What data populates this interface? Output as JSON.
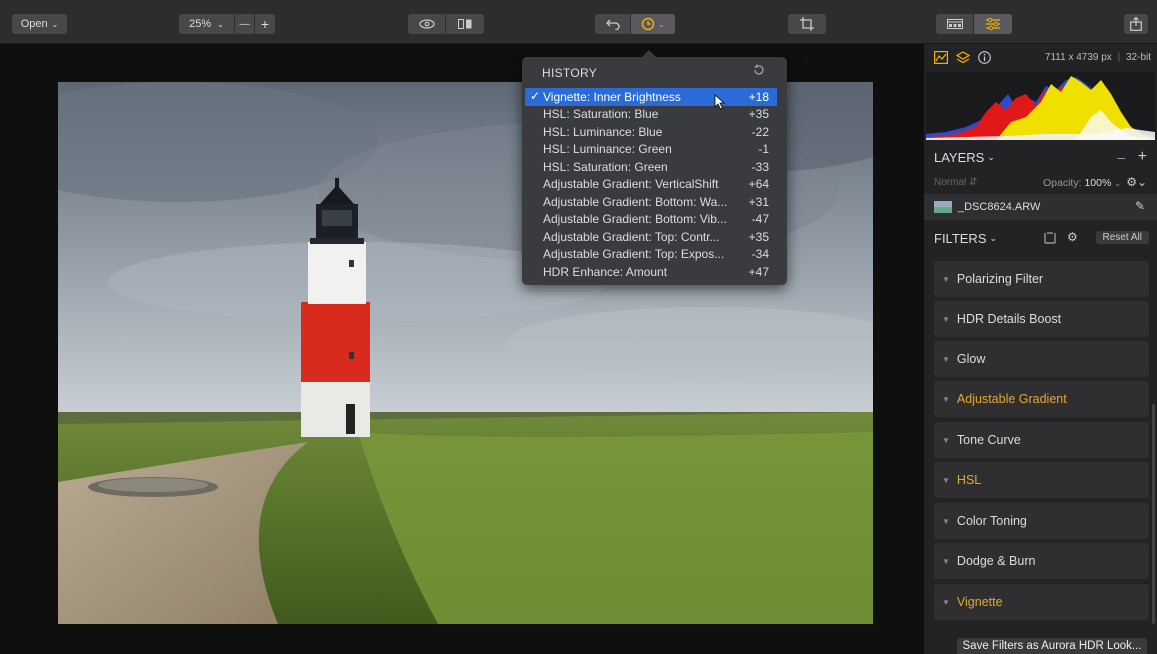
{
  "toolbar": {
    "open_label": "Open",
    "zoom_value": "25%",
    "zoom_minus": "—",
    "zoom_plus": "+"
  },
  "history": {
    "title": "HISTORY",
    "items": [
      {
        "label": "Vignette: Inner Brightness",
        "value": "+18",
        "selected": true
      },
      {
        "label": "HSL: Saturation: Blue",
        "value": "+35"
      },
      {
        "label": "HSL: Luminance: Blue",
        "value": "-22"
      },
      {
        "label": "HSL: Luminance: Green",
        "value": "-1"
      },
      {
        "label": "HSL: Saturation: Green",
        "value": "-33"
      },
      {
        "label": "Adjustable Gradient: VerticalShift",
        "value": "+64"
      },
      {
        "label": "Adjustable Gradient: Bottom: Wa...",
        "value": "+31"
      },
      {
        "label": "Adjustable Gradient: Bottom: Vib...",
        "value": "-47"
      },
      {
        "label": "Adjustable Gradient: Top: Contr...",
        "value": "+35"
      },
      {
        "label": "Adjustable Gradient: Top: Expos...",
        "value": "-34"
      },
      {
        "label": "HDR Enhance: Amount",
        "value": "+47"
      }
    ]
  },
  "image_info": {
    "dimensions": "7111 x 4739 px",
    "bit_depth": "32-bit"
  },
  "layers": {
    "title": "LAYERS",
    "blend_mode": "Normal",
    "opacity_label": "Opacity:",
    "opacity_value": "100%",
    "layer_name": "_DSC8624.ARW"
  },
  "filters": {
    "title": "FILTERS",
    "reset_label": "Reset All",
    "items": [
      {
        "label": "Polarizing Filter",
        "active": false
      },
      {
        "label": "HDR Details Boost",
        "active": false
      },
      {
        "label": "Glow",
        "active": false
      },
      {
        "label": "Adjustable Gradient",
        "active": true
      },
      {
        "label": "Tone Curve",
        "active": false
      },
      {
        "label": "HSL",
        "active": true
      },
      {
        "label": "Color Toning",
        "active": false
      },
      {
        "label": "Dodge & Burn",
        "active": false
      },
      {
        "label": "Vignette",
        "active": true
      }
    ],
    "save_label": "Save Filters as Aurora HDR Look..."
  },
  "colors": {
    "accent": "#f0b400",
    "selection": "#2a6bd8",
    "filter_active": "#e4a82b"
  }
}
